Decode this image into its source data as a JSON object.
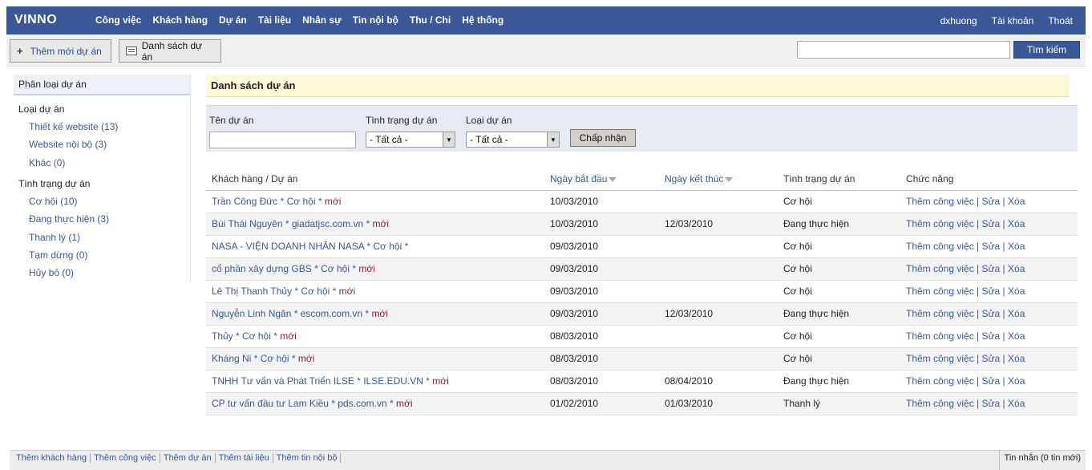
{
  "app": {
    "logo": "VINNO"
  },
  "topnav": [
    "Công việc",
    "Khách hàng",
    "Dự án",
    "Tài liệu",
    "Nhân sự",
    "Tin nội bộ",
    "Thu / Chi",
    "Hệ thống"
  ],
  "usernav": {
    "username": "dxhuong",
    "account": "Tài khoản",
    "logout": "Thoát"
  },
  "toolbar": {
    "add_project": "Thêm mới dự án",
    "list_projects": "Danh sách dự án",
    "search_value": "",
    "search_button": "Tìm kiếm"
  },
  "sidebar": {
    "title": "Phân loại dự án",
    "type_heading": "Loại dự án",
    "types": [
      "Thiết kế website (13)",
      "Website nội bộ (3)",
      "Khác (0)"
    ],
    "status_heading": "Tình trạng dự án",
    "statuses": [
      "Cơ hội (10)",
      "Đang thực hiện (3)",
      "Thanh lý (1)",
      "Tạm dừng (0)",
      "Hủy bỏ (0)"
    ]
  },
  "main": {
    "title": "Danh sách dự án"
  },
  "filter": {
    "name_label": "Tên dự án",
    "name_value": "",
    "status_label": "Tình trạng dự án",
    "status_selected": "- Tất cả -",
    "type_label": "Loại dự án",
    "type_selected": "- Tất cả -",
    "accept_button": "Chấp nhận"
  },
  "table": {
    "headers": [
      "Khách hàng / Dự án",
      "Ngày bắt đầu",
      "Ngày kết thúc",
      "Tình trạng dự án",
      "Chức năng"
    ],
    "action_labels": [
      "Thêm công việc",
      "Sửa",
      "Xóa"
    ],
    "rows": [
      {
        "project": "Trần Công Đức * Cơ hội *",
        "tag": " mới",
        "start": "10/03/2010",
        "end": "",
        "status": "Cơ hội"
      },
      {
        "project": "Bùi Thái Nguyên * giadatjsc.com.vn *",
        "tag": " mới",
        "start": "10/03/2010",
        "end": "12/03/2010",
        "status": "Đang thực hiện"
      },
      {
        "project": "NASA - VIỆN DOANH NHÂN NASA * Cơ hội *",
        "tag": "",
        "start": "09/03/2010",
        "end": "",
        "status": "Cơ hội"
      },
      {
        "project": "cổ phần xây dựng GBS * Cơ hội *",
        "tag": " mới",
        "start": "09/03/2010",
        "end": "",
        "status": "Cơ hội"
      },
      {
        "project": "Lê Thị Thanh Thủy * Cơ hội *",
        "tag": " mới",
        "start": "09/03/2010",
        "end": "",
        "status": "Cơ hội"
      },
      {
        "project": "Nguyễn Linh Ngân * escom.com.vn *",
        "tag": " mới",
        "start": "09/03/2010",
        "end": "12/03/2010",
        "status": "Đang thực hiện"
      },
      {
        "project": "Thủy * Cơ hội *",
        "tag": " mới",
        "start": "08/03/2010",
        "end": "",
        "status": "Cơ hội"
      },
      {
        "project": "Kháng Ni * Cơ hội *",
        "tag": " mới",
        "start": "08/03/2010",
        "end": "",
        "status": "Cơ hội"
      },
      {
        "project": "TNHH Tư vấn và Phát Triển ILSE * ILSE.EDU.VN *",
        "tag": " mới",
        "start": "08/03/2010",
        "end": "08/04/2010",
        "status": "Đang thực hiện"
      },
      {
        "project": "CP tư vấn đầu tư Lam Kiều * pds.com.vn *",
        "tag": " mới",
        "start": "01/02/2010",
        "end": "01/03/2010",
        "status": "Thanh lý"
      }
    ]
  },
  "footer": {
    "links": [
      "Thêm khách hàng",
      "Thêm công việc",
      "Thêm dự án",
      "Thêm tài liệu",
      "Thêm tin nội bộ"
    ],
    "messages": "Tin nhắn (0 tin mới)"
  },
  "colors": {
    "brand": "#3a5897",
    "new_tag": "#8a1f3f",
    "title_bg": "#fff8d6",
    "filter_bg": "#e6ebf3"
  }
}
